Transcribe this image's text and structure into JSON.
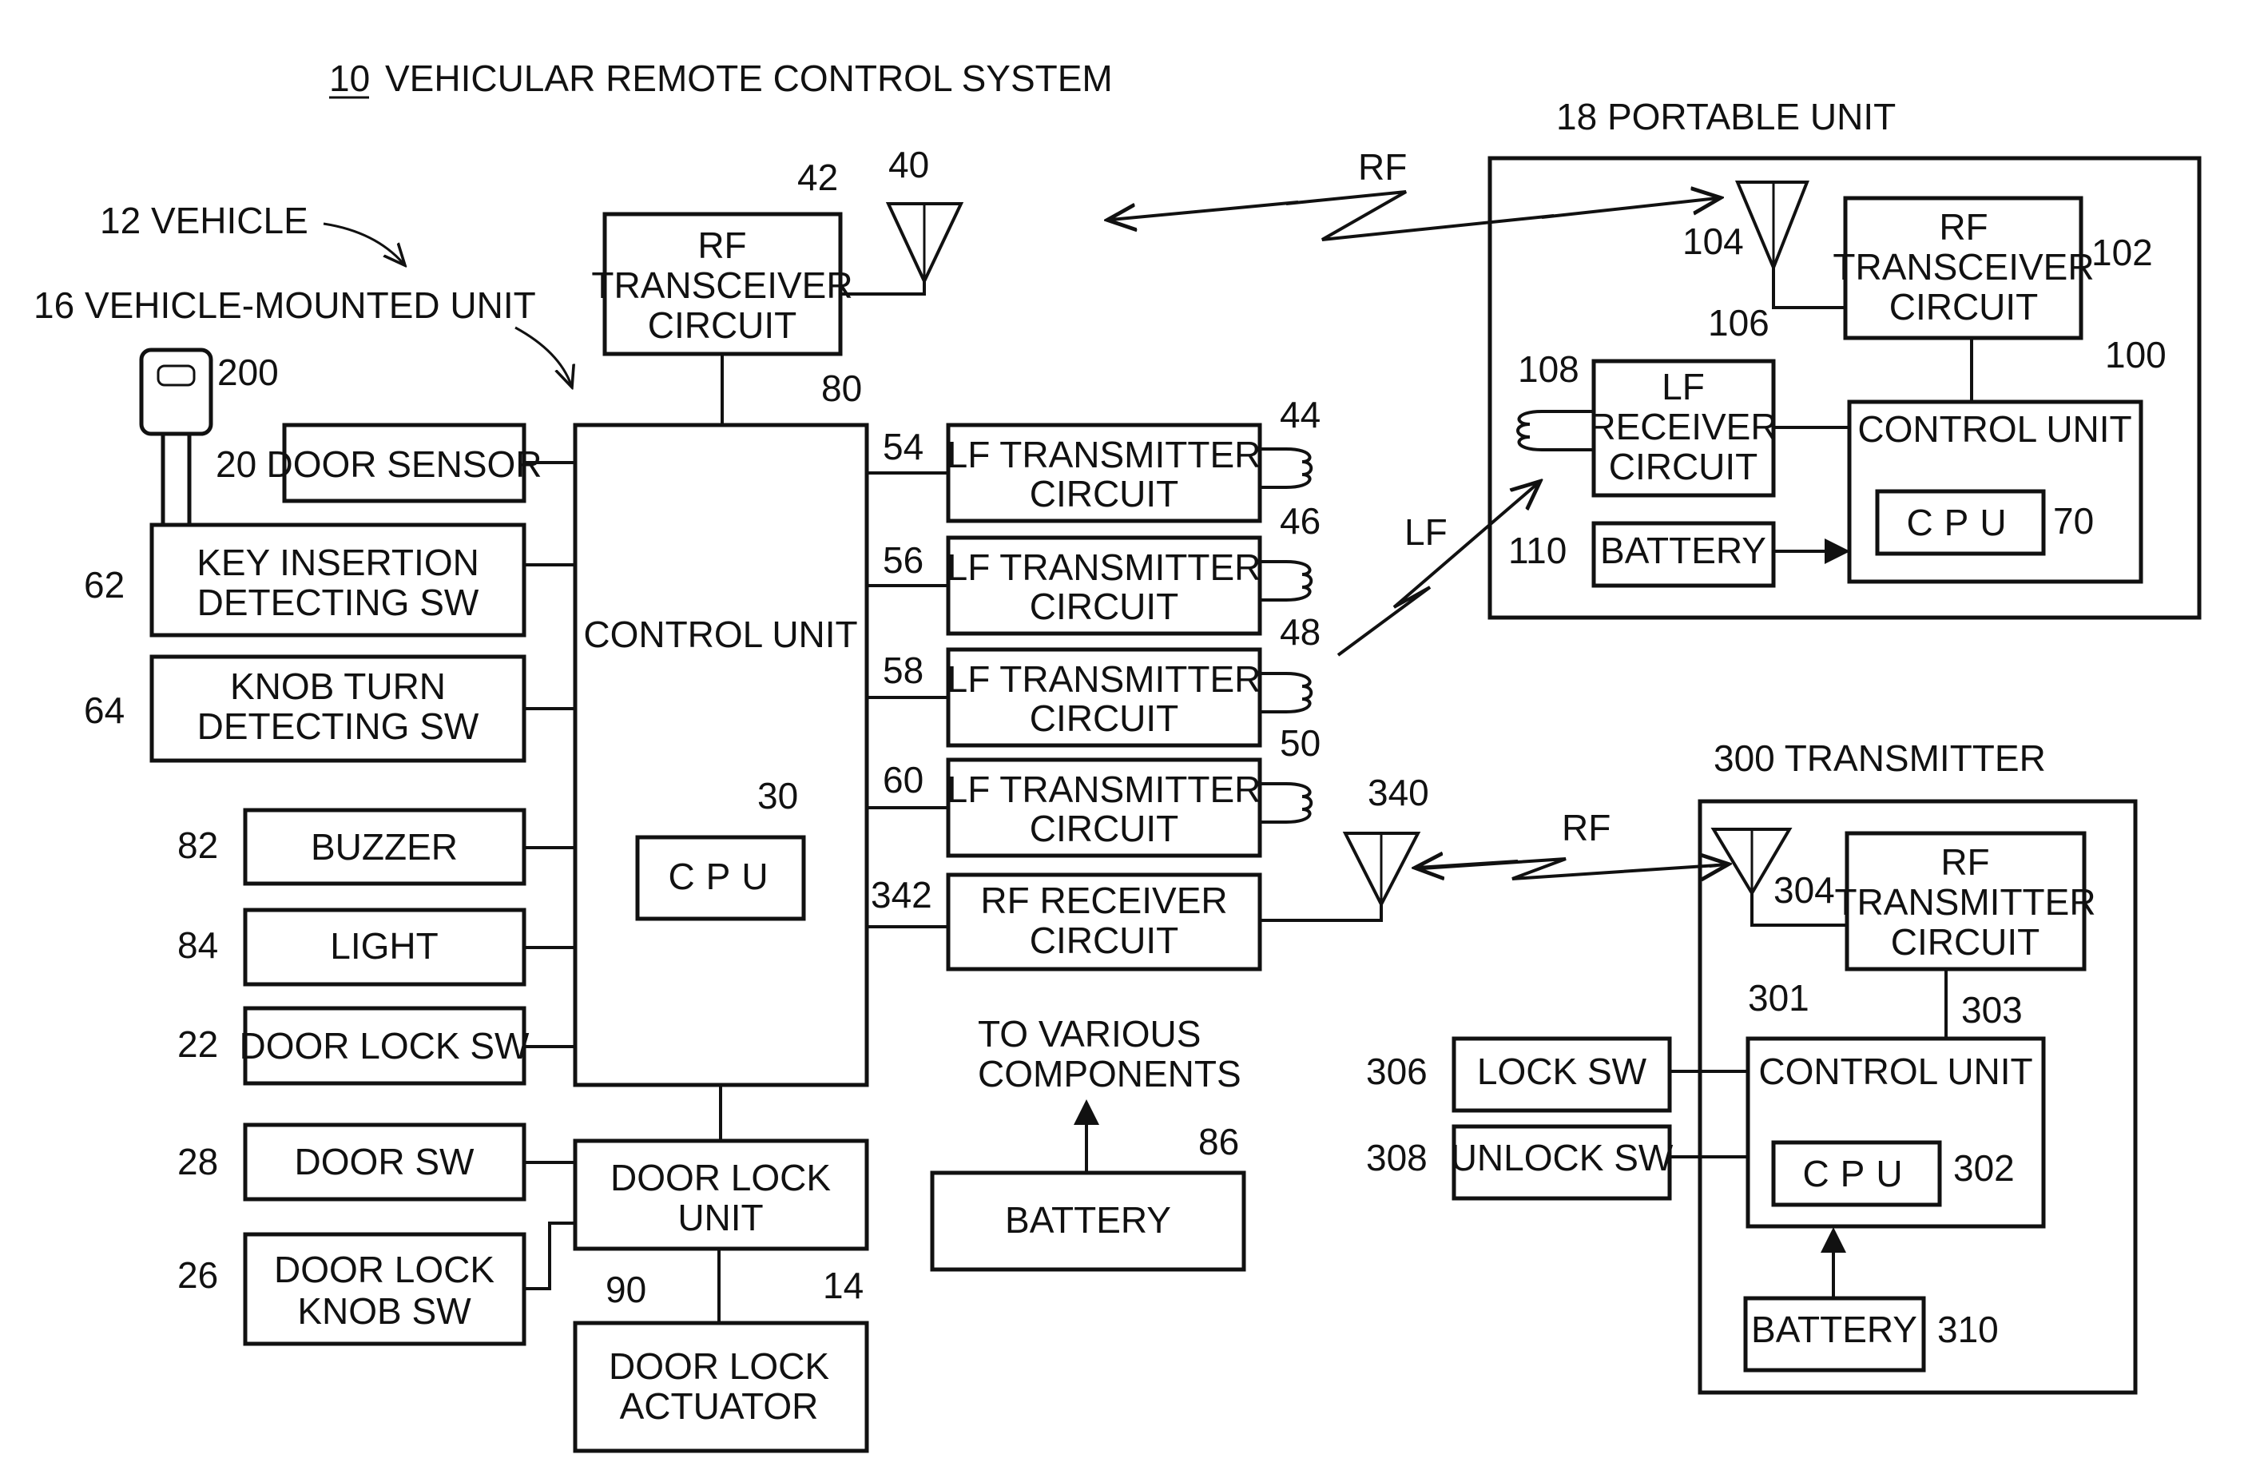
{
  "title": {
    "ref": "10",
    "text": "VEHICULAR REMOTE CONTROL SYSTEM"
  },
  "vehicle": {
    "label": "12 VEHICLE"
  },
  "vehicle_unit": {
    "label": "16 VEHICLE-MOUNTED UNIT"
  },
  "key": {
    "ref": "200"
  },
  "blocks": {
    "rf_transceiver": {
      "lines": [
        "RF",
        "TRANSCEIVER",
        "CIRCUIT"
      ],
      "ref": "42"
    },
    "antenna_40": {
      "ref": "40"
    },
    "control_unit": {
      "label": "CONTROL UNIT",
      "ref": "80"
    },
    "cpu_30": {
      "label": "CPU",
      "ref": "30"
    },
    "door_sensor": {
      "label": "DOOR SENSOR",
      "ref": "20"
    },
    "key_insertion": {
      "lines": [
        "KEY INSERTION",
        "DETECTING SW"
      ],
      "ref": "62"
    },
    "knob_turn": {
      "lines": [
        "KNOB TURN",
        "DETECTING SW"
      ],
      "ref": "64"
    },
    "buzzer": {
      "label": "BUZZER",
      "ref": "82"
    },
    "light": {
      "label": "LIGHT",
      "ref": "84"
    },
    "door_lock_sw": {
      "label": "DOOR LOCK SW",
      "ref": "22"
    },
    "door_sw": {
      "label": "DOOR SW",
      "ref": "28"
    },
    "door_lock_knob_sw": {
      "lines": [
        "DOOR LOCK",
        "KNOB SW"
      ],
      "ref": "26"
    },
    "door_lock_unit": {
      "lines": [
        "DOOR LOCK",
        "UNIT"
      ],
      "ref": "90"
    },
    "door_lock_actuator": {
      "lines": [
        "DOOR LOCK",
        "ACTUATOR"
      ],
      "ref": "14"
    },
    "lf_tx": [
      {
        "lines": [
          "LF TRANSMITTER",
          "CIRCUIT"
        ],
        "ref": "54",
        "coil": "44"
      },
      {
        "lines": [
          "LF TRANSMITTER",
          "CIRCUIT"
        ],
        "ref": "56",
        "coil": "46"
      },
      {
        "lines": [
          "LF TRANSMITTER",
          "CIRCUIT"
        ],
        "ref": "58",
        "coil": "48"
      },
      {
        "lines": [
          "LF TRANSMITTER",
          "CIRCUIT"
        ],
        "ref": "60",
        "coil": "50"
      }
    ],
    "rf_receiver": {
      "lines": [
        "RF RECEIVER",
        "CIRCUIT"
      ],
      "ref": "342"
    },
    "antenna_340": {
      "ref": "340"
    },
    "battery_86": {
      "label": "BATTERY",
      "ref": "86",
      "note": [
        "TO VARIOUS",
        "COMPONENTS"
      ]
    }
  },
  "signals": {
    "rf_top": "RF",
    "lf": "LF",
    "rf_bottom": "RF"
  },
  "portable": {
    "label": "18 PORTABLE UNIT",
    "rf_transceiver": {
      "lines": [
        "RF",
        "TRANSCEIVER",
        "CIRCUIT"
      ],
      "ref": "102"
    },
    "antenna": {
      "ref": "104"
    },
    "lf_receiver": {
      "lines": [
        "LF",
        "RECEIVER",
        "CIRCUIT"
      ],
      "ref": "106"
    },
    "coil": {
      "ref": "108"
    },
    "control_unit": {
      "label": "CONTROL UNIT",
      "ref": "100"
    },
    "cpu": {
      "label": "CPU",
      "ref": "70"
    },
    "battery": {
      "label": "BATTERY",
      "ref": "110"
    }
  },
  "transmitter": {
    "label": "300 TRANSMITTER",
    "rf_transmitter": {
      "lines": [
        "RF",
        "TRANSMITTER",
        "CIRCUIT"
      ],
      "ref": "303"
    },
    "antenna": {
      "ref": "304"
    },
    "control_unit": {
      "label": "CONTROL UNIT",
      "ref": "301"
    },
    "cpu": {
      "label": "CPU",
      "ref": "302"
    },
    "battery": {
      "label": "BATTERY",
      "ref": "310"
    },
    "lock_sw": {
      "label": "LOCK SW",
      "ref": "306"
    },
    "unlock_sw": {
      "label": "UNLOCK SW",
      "ref": "308"
    }
  }
}
